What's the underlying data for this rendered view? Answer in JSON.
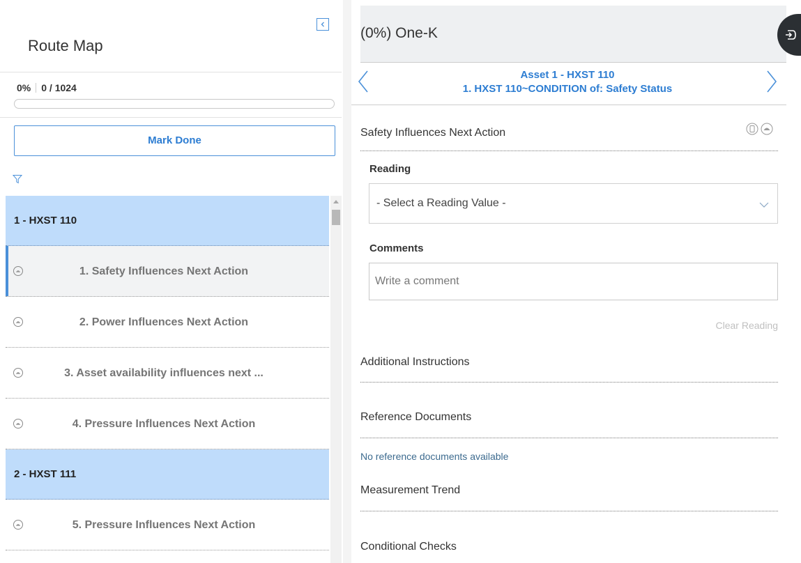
{
  "route_map": {
    "title": "Route Map",
    "progress_percent": "0%",
    "progress_count": "0 / 1024",
    "progress_value": 0,
    "mark_done_label": "Mark Done",
    "groups": [
      {
        "label": "1 - HXST 110",
        "steps": [
          {
            "label": "1. Safety Influences Next Action",
            "selected": true
          },
          {
            "label": "2. Power Influences Next Action",
            "selected": false
          },
          {
            "label": "3. Asset availability influences next ...",
            "selected": false
          },
          {
            "label": "4. Pressure Influences Next Action",
            "selected": false
          }
        ]
      },
      {
        "label": "2 - HXST 111",
        "steps": [
          {
            "label": "5. Pressure Influences Next Action",
            "selected": false
          }
        ]
      }
    ]
  },
  "detail": {
    "title": "(0%) One-K",
    "asset_line1": "Asset 1 - HXST 110",
    "asset_line2": "1. HXST 110~CONDITION of: Safety Status",
    "step_title": "Safety Influences Next Action",
    "reading_label": "Reading",
    "reading_value": "- Select a Reading Value -",
    "comments_label": "Comments",
    "comments_placeholder": "Write a comment",
    "clear_reading_label": "Clear Reading",
    "additional_instructions": "Additional Instructions",
    "reference_documents": "Reference Documents",
    "no_reference": "No reference documents available",
    "measurement_trend": "Measurement Trend",
    "conditional_checks": "Conditional Checks"
  },
  "colors": {
    "accent": "#2d7dd2",
    "group_header_bg": "#bfdcfb",
    "side_tab": "#2b2f33"
  },
  "icons": [
    "collapse-panel-icon",
    "filter-icon",
    "step-status-icon",
    "chevron-left-icon",
    "chevron-right-icon",
    "device-icon",
    "status-icon",
    "chevron-down-icon",
    "side-panel-icon"
  ]
}
